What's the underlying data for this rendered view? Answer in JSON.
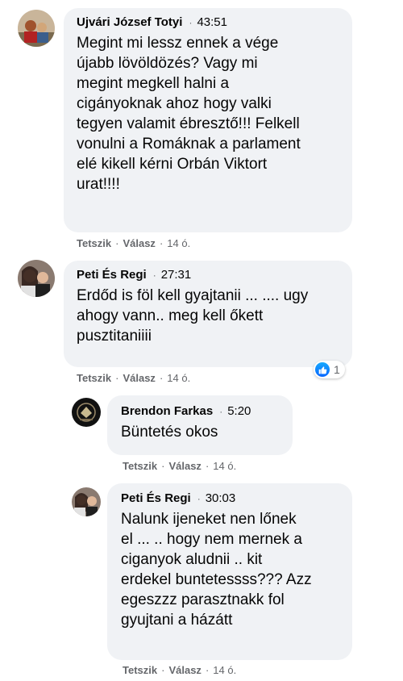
{
  "comments": [
    {
      "author": "Ujvári József Totyi",
      "time": "43:51",
      "text": "Megint mi lessz ennek a vége\nújabb lövöldözés? Vagy mi\nmegint megkell halni a\ncigányoknak ahoz hogy valki\ntegyen valamit ébresztő!!! Felkell\nvonulni a Romáknak a parlament\nelé kikell kérni Orbán Viktort\nurat!!!!",
      "like": "Tetszik",
      "reply": "Válasz",
      "age": "14 ó."
    },
    {
      "author": "Peti És Regi",
      "time": "27:31",
      "text": "Erdőd is föl kell gyajtanii ... .... ugy\nahogy vann.. meg kell őkett\npusztitaniiii",
      "like": "Tetszik",
      "reply": "Válasz",
      "age": "14 ó.",
      "reaction_count": "1"
    },
    {
      "author": "Brendon Farkas",
      "time": "5:20",
      "text": "Büntetés okos",
      "like": "Tetszik",
      "reply": "Válasz",
      "age": "14 ó."
    },
    {
      "author": "Peti És Regi",
      "time": "30:03",
      "text": "Nalunk ijeneket nen lőnek\nel ... .. hogy nem mernek a\nciganyok aludnii .. kit\nerdekel buntetessss??? Azz\negeszzz parasztnakk fol\ngyujtani a házátt",
      "like": "Tetszik",
      "reply": "Válasz",
      "age": "14 ó."
    }
  ],
  "separator": "·",
  "colors": {
    "bubble": "#f0f2f5",
    "meta": "#65676b",
    "like_blue": "#0866ff"
  }
}
